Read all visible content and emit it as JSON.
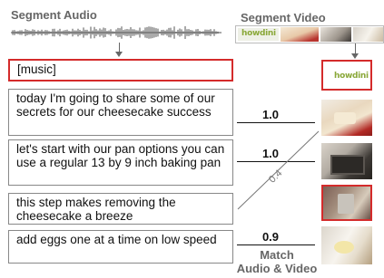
{
  "headers": {
    "audio": "Segment Audio",
    "video": "Segment Video"
  },
  "brand": {
    "logo_text": "howdini",
    "logo_color": "#8aa839"
  },
  "segments": [
    {
      "text": "[music]",
      "highlighted": true
    },
    {
      "text": "today I'm going to share some of our secrets for our cheesecake success",
      "highlighted": false
    },
    {
      "text": "let's start with our pan options you can use a regular 13 by 9 inch baking pan",
      "highlighted": false
    },
    {
      "text": "this step makes removing the cheesecake a breeze",
      "highlighted": false
    },
    {
      "text": "add eggs one at a time on low speed",
      "highlighted": false
    }
  ],
  "scores": {
    "cheesecake_match": "1.0",
    "pan_match": "1.0",
    "diagonal_match": "0.4",
    "eggs_match": "0.9"
  },
  "footer": {
    "line1": "Match",
    "line2": "Audio & Video"
  },
  "colors": {
    "highlight": "#d42b2b",
    "header_text": "#666666"
  }
}
